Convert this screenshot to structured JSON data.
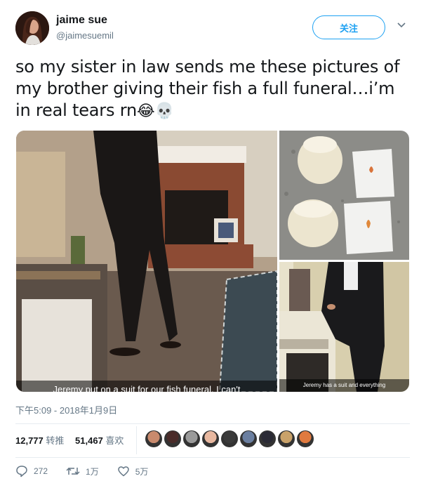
{
  "user": {
    "name": "jaime sue",
    "handle": "@jaimesuemil"
  },
  "follow_label": "关注",
  "tweet": {
    "text_lines": [
      "so my sister in law sends me these pictures of",
      "my brother giving their fish a full funeral…i’m",
      "in real tears rn"
    ],
    "emoji": [
      "😂",
      "💀"
    ]
  },
  "media": {
    "caption_main": "Jeremy put on a suit for our fish funeral. I can't",
    "caption_side": "Jeremy has a suit and everything"
  },
  "timestamp": "下午5:09 - 2018年1月9日",
  "stats": {
    "retweets_count": "12,777",
    "retweets_label": "转推",
    "likes_count": "51,467",
    "likes_label": "喜欢"
  },
  "likers": [
    "#c98a6d",
    "#4a2c2a",
    "#9a9a9a",
    "#e8b8a0",
    "#3b3b3b",
    "#6b7fa0",
    "#2a2a35",
    "#c9a26a",
    "#e07a3f"
  ],
  "actions": {
    "replies": "272",
    "retweets": "1万",
    "likes": "5万"
  },
  "colors": {
    "accent": "#1da1f2",
    "secondary_text": "#657786",
    "divider": "#e6ecf0"
  }
}
